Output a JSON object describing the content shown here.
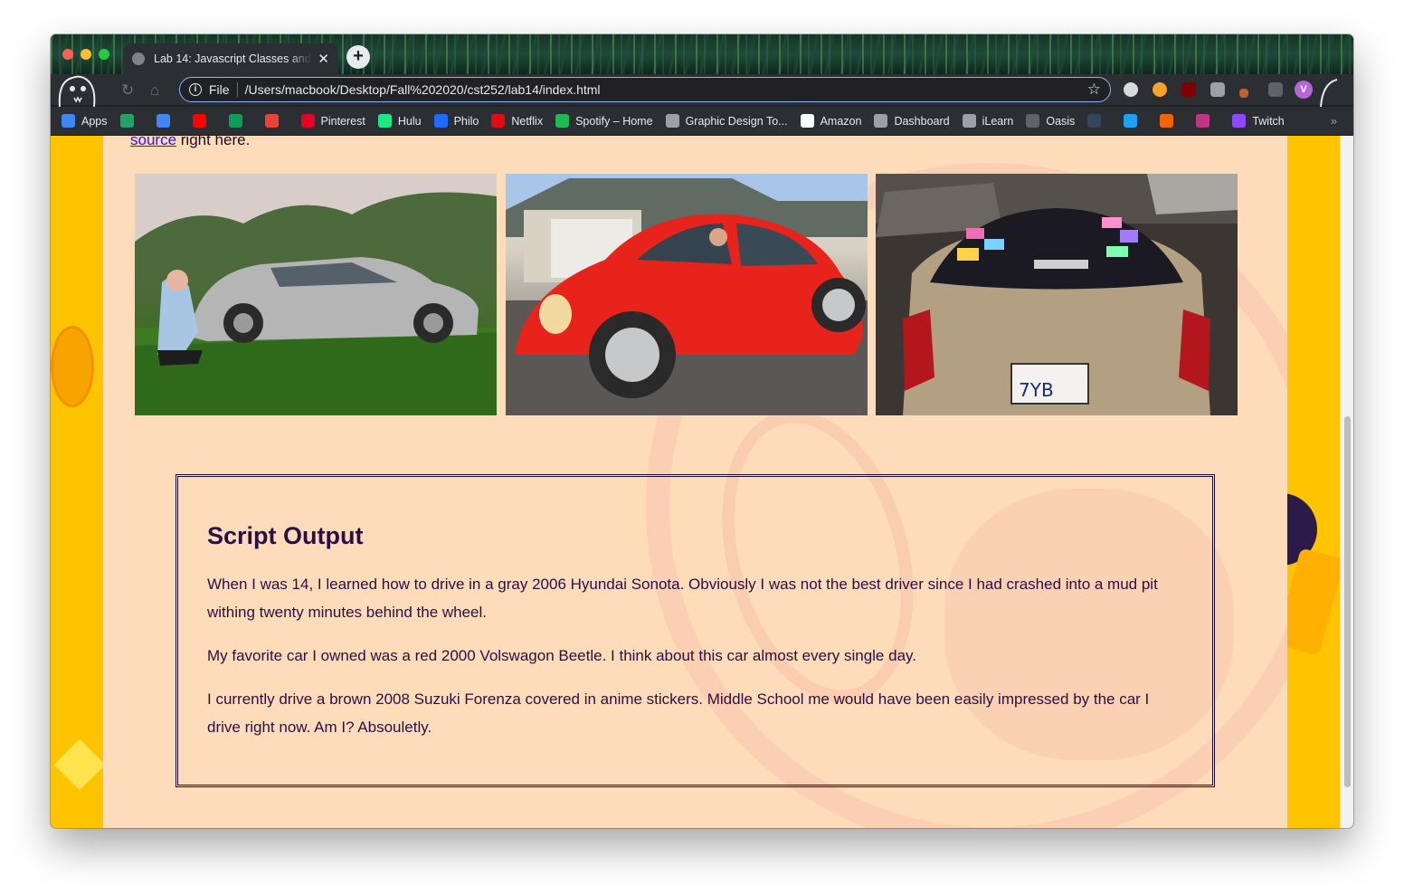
{
  "browser": {
    "tab_title": "Lab 14: Javascript Classes and",
    "url_scheme": "File",
    "url": "/Users/macbook/Desktop/Fall%202020/cst252/lab14/index.html",
    "avatar_letter": "V"
  },
  "bookmarks": [
    {
      "label": "Apps",
      "icon": "apps-grid-icon",
      "color": "#4285f4"
    },
    {
      "label": "",
      "icon": "google-drive-icon",
      "color": "#1fa463"
    },
    {
      "label": "",
      "icon": "google-docs-icon",
      "color": "#4285f4"
    },
    {
      "label": "",
      "icon": "youtube-icon",
      "color": "#ff0000"
    },
    {
      "label": "",
      "icon": "google-sheets-icon",
      "color": "#0f9d58"
    },
    {
      "label": "",
      "icon": "gmail-icon",
      "color": "#ea4335"
    },
    {
      "label": "Pinterest",
      "icon": "pinterest-icon",
      "color": "#e60023"
    },
    {
      "label": "Hulu",
      "icon": "hulu-icon",
      "color": "#1ce783"
    },
    {
      "label": "Philo",
      "icon": "philo-icon",
      "color": "#1f6bff"
    },
    {
      "label": "Netflix",
      "icon": "netflix-icon",
      "color": "#e50914"
    },
    {
      "label": "Spotify – Home",
      "icon": "spotify-icon",
      "color": "#1db954"
    },
    {
      "label": "Graphic Design To...",
      "icon": "folder-icon",
      "color": "#9aa0a6"
    },
    {
      "label": "Amazon",
      "icon": "amazon-icon",
      "color": "#ffffff"
    },
    {
      "label": "Dashboard",
      "icon": "dashboard-icon",
      "color": "#9aa0a6"
    },
    {
      "label": "iLearn",
      "icon": "ilearn-icon",
      "color": "#9aa0a6"
    },
    {
      "label": "Oasis",
      "icon": "oasis-icon",
      "color": "#5f6368"
    },
    {
      "label": "",
      "icon": "tumblr-icon",
      "color": "#35465c"
    },
    {
      "label": "",
      "icon": "twitter-icon",
      "color": "#1da1f2"
    },
    {
      "label": "",
      "icon": "etsy-icon",
      "color": "#f56400"
    },
    {
      "label": "",
      "icon": "instagram-icon",
      "color": "#c13584"
    },
    {
      "label": "Twitch",
      "icon": "twitch-icon",
      "color": "#9146ff"
    }
  ],
  "page": {
    "intro_link": "source",
    "intro_rest": " right here.",
    "photos": [
      {
        "alt": "gray car in mud pit"
      },
      {
        "alt": "red beetle"
      },
      {
        "alt": "brown car with anime stickers"
      }
    ],
    "output": {
      "heading": "Script Output",
      "paragraphs": [
        "When I was 14, I learned how to drive in a gray 2006 Hyundai Sonota. Obviously I was not the best driver since I had crashed into a mud pit withing twenty minutes behind the wheel.",
        "My favorite car I owned was a red 2000 Volswagon Beetle. I think about this car almost every single day.",
        "I currently drive a brown 2008 Suzuki Forenza covered in anime stickers. Middle School me would have been easily impressed by the car I drive right now. Am I? Absouletly."
      ]
    }
  },
  "colors": {
    "page_bg": "#ffc400",
    "content_bg": "#fedcba",
    "text": "#2a0f46",
    "link": "#2b11ff"
  }
}
